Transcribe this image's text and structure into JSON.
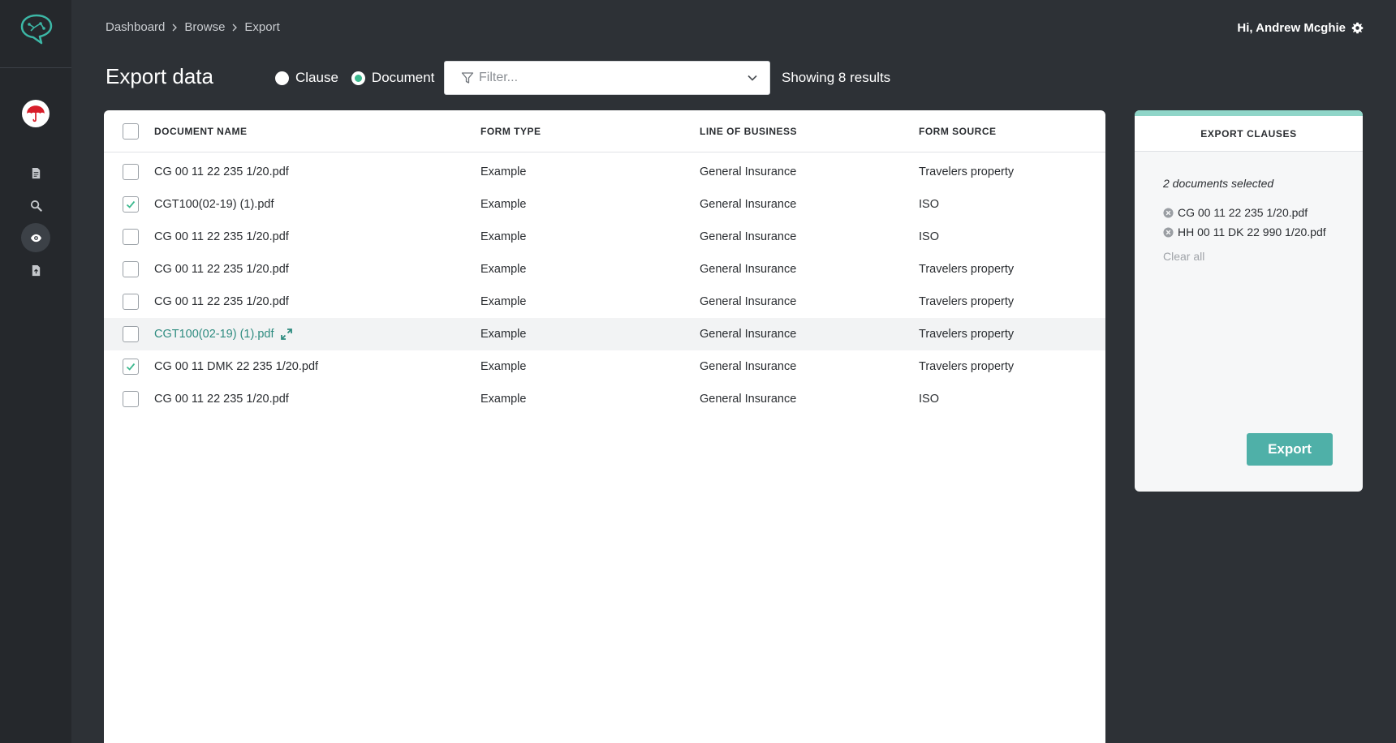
{
  "breadcrumb": [
    "Dashboard",
    "Browse",
    "Export"
  ],
  "user": {
    "greeting": "Hi, Andrew Mcghie"
  },
  "page": {
    "title": "Export data"
  },
  "mode": {
    "options": [
      "Clause",
      "Document"
    ],
    "selected": "Document"
  },
  "filter": {
    "placeholder": "Filter..."
  },
  "results_text": "Showing 8 results",
  "table": {
    "headers": [
      "DOCUMENT NAME",
      "FORM TYPE",
      "LINE OF BUSINESS",
      "FORM SOURCE"
    ],
    "rows": [
      {
        "name": "CG 00 11 22 235 1/20.pdf",
        "type": "Example",
        "lob": "General Insurance",
        "source": "Travelers property",
        "checked": false
      },
      {
        "name": "CGT100(02-19) (1).pdf",
        "type": "Example",
        "lob": "General Insurance",
        "source": "ISO",
        "checked": true
      },
      {
        "name": "CG 00 11 22 235 1/20.pdf",
        "type": "Example",
        "lob": "General Insurance",
        "source": "ISO",
        "checked": false
      },
      {
        "name": "CG 00 11 22 235 1/20.pdf",
        "type": "Example",
        "lob": "General Insurance",
        "source": "Travelers property",
        "checked": false
      },
      {
        "name": "CG 00 11 22 235 1/20.pdf",
        "type": "Example",
        "lob": "General Insurance",
        "source": "Travelers property",
        "checked": false
      },
      {
        "name": "CGT100(02-19) (1).pdf",
        "type": "Example",
        "lob": "General Insurance",
        "source": "Travelers property",
        "checked": false,
        "hover": true
      },
      {
        "name": "CG 00 11 DMK 22 235 1/20.pdf",
        "type": "Example",
        "lob": "General Insurance",
        "source": "Travelers property",
        "checked": true
      },
      {
        "name": "CG 00 11 22 235 1/20.pdf",
        "type": "Example",
        "lob": "General Insurance",
        "source": "ISO",
        "checked": false
      }
    ]
  },
  "export_panel": {
    "title": "EXPORT CLAUSES",
    "selected_count": "2 documents selected",
    "selected_items": [
      "CG 00 11 22 235 1/20.pdf",
      "HH 00 11 DK 22 990 1/20.pdf"
    ],
    "clear_all": "Clear all",
    "export_label": "Export"
  },
  "colors": {
    "accent": "#4fb0a8",
    "check": "#3cb98f",
    "link": "#2f8c80",
    "background": "#2d3136",
    "sidebar": "#25282c",
    "brand_red": "#d81e2a"
  },
  "icons": {
    "logo": "chat-bubble-logo",
    "brand": "umbrella-icon",
    "nav": [
      "document-icon",
      "search-icon",
      "eye-icon",
      "file-upload-icon"
    ],
    "settings": "gear-icon"
  }
}
